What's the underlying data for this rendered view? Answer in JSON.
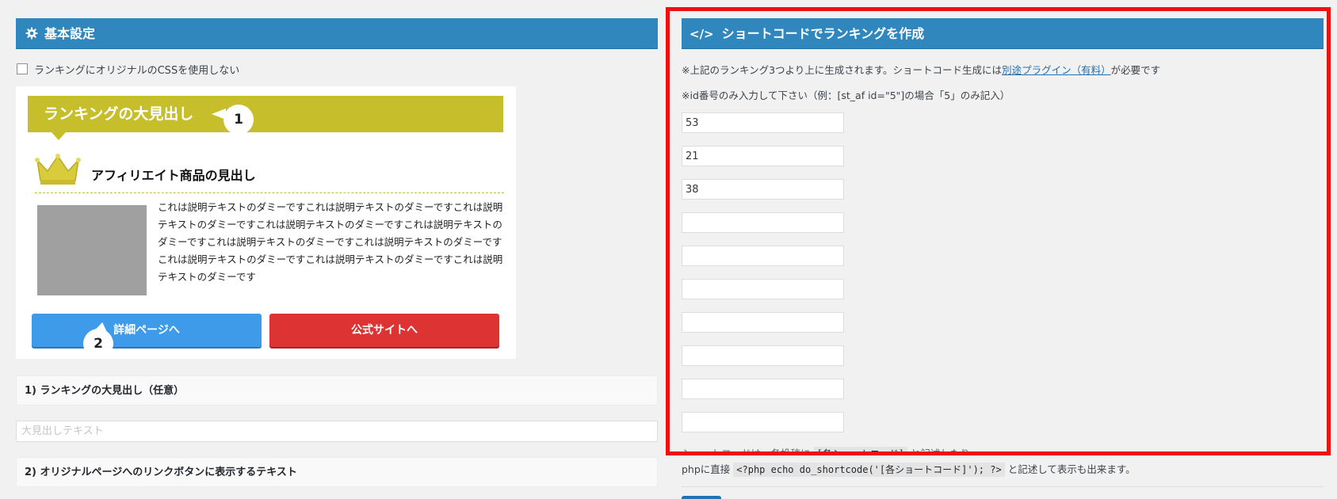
{
  "basic_settings": {
    "title": "基本設定",
    "icon": "gear-icon"
  },
  "css_option": {
    "label": "ランキングにオリジナルのCSSを使用しない",
    "checked": false
  },
  "preview": {
    "ranking_heading": "ランキングの大見出し",
    "callout_1": "1",
    "callout_2": "2",
    "product_title": "アフィリエイト商品の見出し",
    "crown_icon": "crown-icon",
    "description": "これは説明テキストのダミーですこれは説明テキストのダミーですこれは説明テキストのダミーですこれは説明テキストのダミーですこれは説明テキストのダミーですこれは説明テキストのダミーですこれは説明テキストのダミーですこれは説明テキストのダミーですこれは説明テキストのダミーですこれは説明テキストのダミーです",
    "detail_button": "詳細ページへ",
    "official_button": "公式サイトへ",
    "colors": {
      "heading": "#c6bf2b",
      "detail_button": "#3d9be9",
      "official_button": "#dd3333"
    }
  },
  "field1": {
    "label": "1) ランキングの大見出し（任意）",
    "placeholder": "大見出しテキスト",
    "value": ""
  },
  "field2": {
    "label": "2) オリジナルページへのリンクボタンに表示するテキスト"
  },
  "shortcode": {
    "title": "ショートコードでランキングを作成",
    "icon": "code-icon",
    "note1_prefix": "※上記のランキング3つより上に生成されます。ショートコード生成には",
    "note1_link": "別途プラグイン（有料）",
    "note1_suffix": "が必要です",
    "note2": "※id番号のみ入力して下さい（例：[st_af id=\"5\"]の場合「5」のみ記入）",
    "ids": [
      "53",
      "21",
      "38",
      "",
      "",
      "",
      "",
      "",
      "",
      ""
    ],
    "partial_line_1": "ショートコードは、各投稿に",
    "partial_code": "[各ショートコード]",
    "partial_line_2": "と記述したり",
    "php_prefix": "phpに直接",
    "php_code": "<?php echo do_shortcode('[各ショートコード]'); ?>",
    "php_suffix": "と記述して表示も出来ます。"
  },
  "highlight_color": "#ee1111",
  "header_color": "#2f87bd"
}
